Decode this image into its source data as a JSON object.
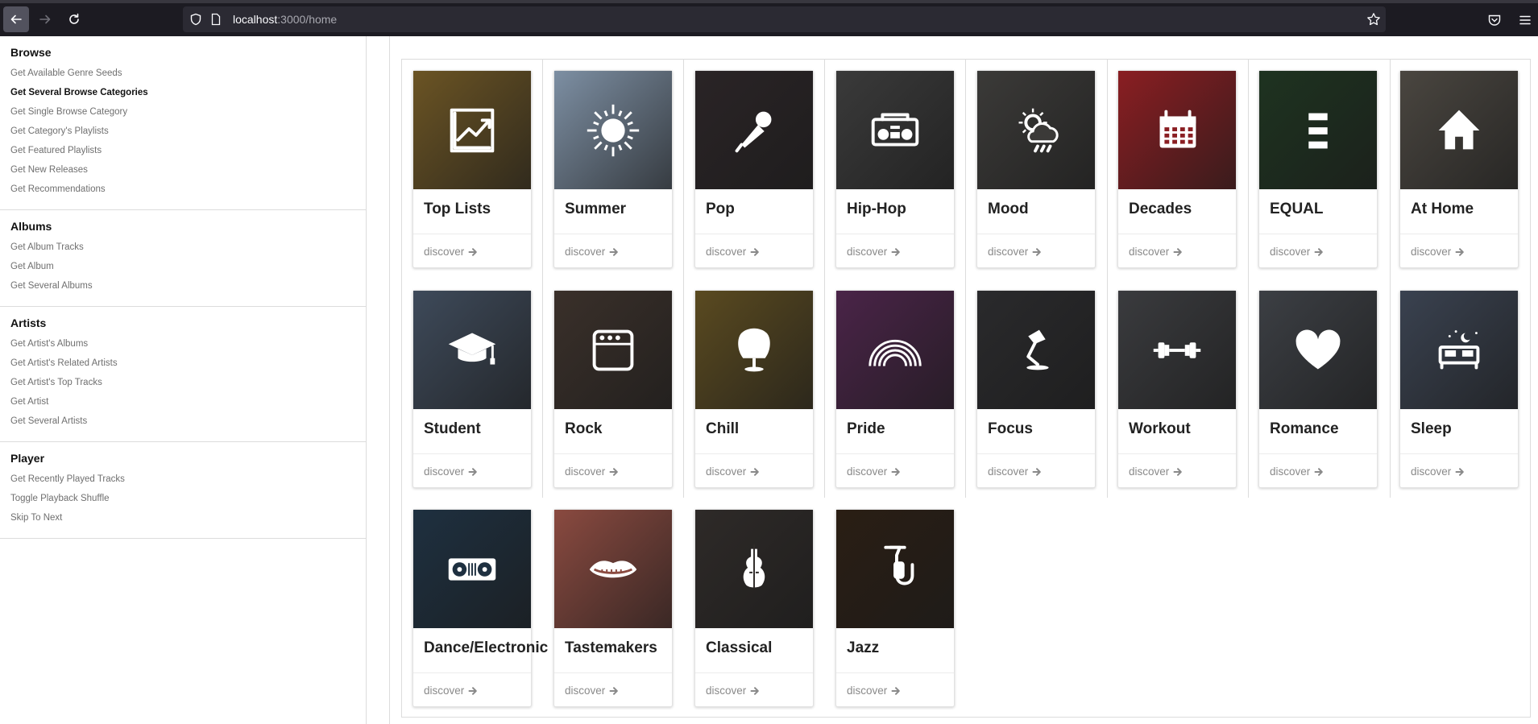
{
  "browser": {
    "url_host": "localhost",
    "url_path": ":3000/home"
  },
  "sidebar": {
    "sections": [
      {
        "title": "Browse",
        "items": [
          "Get Available Genre Seeds",
          "Get Several Browse Categories",
          "Get Single Browse Category",
          "Get Category's Playlists",
          "Get Featured Playlists",
          "Get New Releases",
          "Get Recommendations"
        ],
        "active_index": 1
      },
      {
        "title": "Albums",
        "items": [
          "Get Album Tracks",
          "Get Album",
          "Get Several Albums"
        ],
        "active_index": -1
      },
      {
        "title": "Artists",
        "items": [
          "Get Artist's Albums",
          "Get Artist's Related Artists",
          "Get Artist's Top Tracks",
          "Get Artist",
          "Get Several Artists"
        ],
        "active_index": -1
      },
      {
        "title": "Player",
        "items": [
          "Get Recently Played Tracks",
          "Toggle Playback Shuffle",
          "Skip To Next"
        ],
        "active_index": -1
      }
    ]
  },
  "categories": [
    {
      "name": "Top Lists",
      "icon": "chart-up-icon",
      "bg": "#6b5424",
      "action": "discover"
    },
    {
      "name": "Summer",
      "icon": "sun-icon",
      "bg": "#7d8fa3",
      "action": "discover"
    },
    {
      "name": "Pop",
      "icon": "microphone-icon",
      "bg": "#2a2426",
      "action": "discover"
    },
    {
      "name": "Hip-Hop",
      "icon": "boombox-icon",
      "bg": "#3a3a3a",
      "action": "discover"
    },
    {
      "name": "Mood",
      "icon": "weather-icon",
      "bg": "#3b3a38",
      "action": "discover"
    },
    {
      "name": "Decades",
      "icon": "calendar-icon",
      "bg": "#8a1e22",
      "action": "discover"
    },
    {
      "name": "EQUAL",
      "icon": "equal-bars-icon",
      "bg": "#1e3320",
      "action": "discover"
    },
    {
      "name": "At Home",
      "icon": "house-icon",
      "bg": "#4a4640",
      "action": "discover"
    },
    {
      "name": "Student",
      "icon": "graduation-cap-icon",
      "bg": "#3e4a5a",
      "action": "discover"
    },
    {
      "name": "Rock",
      "icon": "amplifier-icon",
      "bg": "#3a302a",
      "action": "discover"
    },
    {
      "name": "Chill",
      "icon": "egg-chair-icon",
      "bg": "#5a4a20",
      "action": "discover"
    },
    {
      "name": "Pride",
      "icon": "rainbow-icon",
      "bg": "#4a2448",
      "action": "discover"
    },
    {
      "name": "Focus",
      "icon": "desk-lamp-icon",
      "bg": "#2a2a2c",
      "action": "discover"
    },
    {
      "name": "Workout",
      "icon": "dumbbell-icon",
      "bg": "#3a3b3e",
      "action": "discover"
    },
    {
      "name": "Romance",
      "icon": "heart-icon",
      "bg": "#3c3f44",
      "action": "discover"
    },
    {
      "name": "Sleep",
      "icon": "bed-icon",
      "bg": "#3a4250",
      "action": "discover"
    },
    {
      "name": "Dance/Electronic",
      "icon": "turntable-icon",
      "bg": "#1e3040",
      "action": "discover"
    },
    {
      "name": "Tastemakers",
      "icon": "lips-icon",
      "bg": "#8a4a40",
      "action": "discover"
    },
    {
      "name": "Classical",
      "icon": "violin-icon",
      "bg": "#2e2a28",
      "action": "discover"
    },
    {
      "name": "Jazz",
      "icon": "saxophone-icon",
      "bg": "#2a1e14",
      "action": "discover"
    }
  ]
}
